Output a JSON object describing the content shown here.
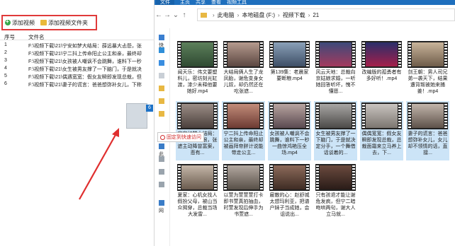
{
  "leftapp": {
    "toolbar": {
      "add_video": "添加视频",
      "add_folder": "添加视频文件夹"
    },
    "headers": {
      "num": "序号",
      "name": "文件名"
    },
    "rows": [
      {
        "num": "1",
        "path": "F:\\视频下载\\21\\宁安如梦大结局：薛远暴大忐怨，张"
      },
      {
        "num": "2",
        "path": "F:\\视频下载\\21\\宁二抖上传命阳止公主和亲，最终却"
      },
      {
        "num": "3",
        "path": "F:\\视频下载\\21\\女孩被人嘲讽不会跳舞，谁料下一秒"
      },
      {
        "num": "4",
        "path": "F:\\视频下载\\21\\女生被男友撑了一下脑门，于是就决"
      },
      {
        "num": "5",
        "path": "F:\\视频下载\\21\\偶遇宽宽：假女友瞬即发现总栽，但"
      },
      {
        "num": "6",
        "path": "F:\\视频下载\\21\\妻子的谎言：爸爸想弥补女儿，下称"
      }
    ],
    "drag_badge": "6"
  },
  "explorer": {
    "ribbon": {
      "tab1": "文件",
      "tab2": "主页",
      "tab3": "共享",
      "tab4": "查看",
      "tab5": "视频工具"
    },
    "nav": {
      "back": "←",
      "forward": "→",
      "down": "⌄",
      "up": "↑"
    },
    "address": {
      "seg1": "此电脑",
      "seg2": "本地磁盘 (F:)",
      "seg3": "视频下载",
      "seg4": "21",
      "sep": "›"
    },
    "navpane": {
      "quick": "快",
      "thispc": "此",
      "network": "网"
    },
    "pin_tip": "固定到快速访问",
    "thumbs": [
      {
        "caption": "闻天乐：伟文要塑料儿，密坊刻光缸渡，漆少未释他要她好.mp4"
      },
      {
        "caption": "大结局俩人生了龙凤胎，谢危变身女儿奴，却仍然还在吃张遮..."
      },
      {
        "caption": "第139集：老晨家要断粮.mp4"
      },
      {
        "caption": "风云天地：总裁向京姑娘求婚，一听她回答听坏，愧不懂愿..."
      },
      {
        "caption": "改编版的孤勇者有多好听！.mp4"
      },
      {
        "caption": "剑王朝：男人司兄弟一袭天下，结果遭背叛被她来捕姜！.mp4"
      },
      {
        "caption": "宁安如梦大结局：薛远暴大忐恨，张遮主动降曾富案，悲有..."
      },
      {
        "caption": "宁二抖上传命阳止公主和亲，最终却被画拜帝胖计说能带走公主..."
      },
      {
        "caption": "女孩被人嘲讽不会跳舞，谁料下一秒一曲惊鸿艳压全场.mp4"
      },
      {
        "caption": "女生被男友撑了一下脑门，于是就决定分手，一个舞借话谈着的..."
      },
      {
        "caption": "偶偶宽宽：假女友瞬即发现总栽，总裁面霜来立马养上去，下..."
      },
      {
        "caption": "妻子的谎言：爸爸想弥补女儿，女儿却不领情的话，直接..."
      },
      {
        "caption": "夏家：心机女找人假扮父母，被山当众揭穿，总裁当场大发雷..."
      },
      {
        "caption": "以萱为萱萱萱打卡即书萱真拍抽血，时萱发现后伸手为书萱遮..."
      },
      {
        "caption": "雇散的心：赵舒城太想玛利亚，把谱户妹子当成她，会诅说出..."
      },
      {
        "caption": "只有孩退才能让谢危发疯，但宁二暗吻哄两句，谢大人立马就..."
      }
    ]
  }
}
